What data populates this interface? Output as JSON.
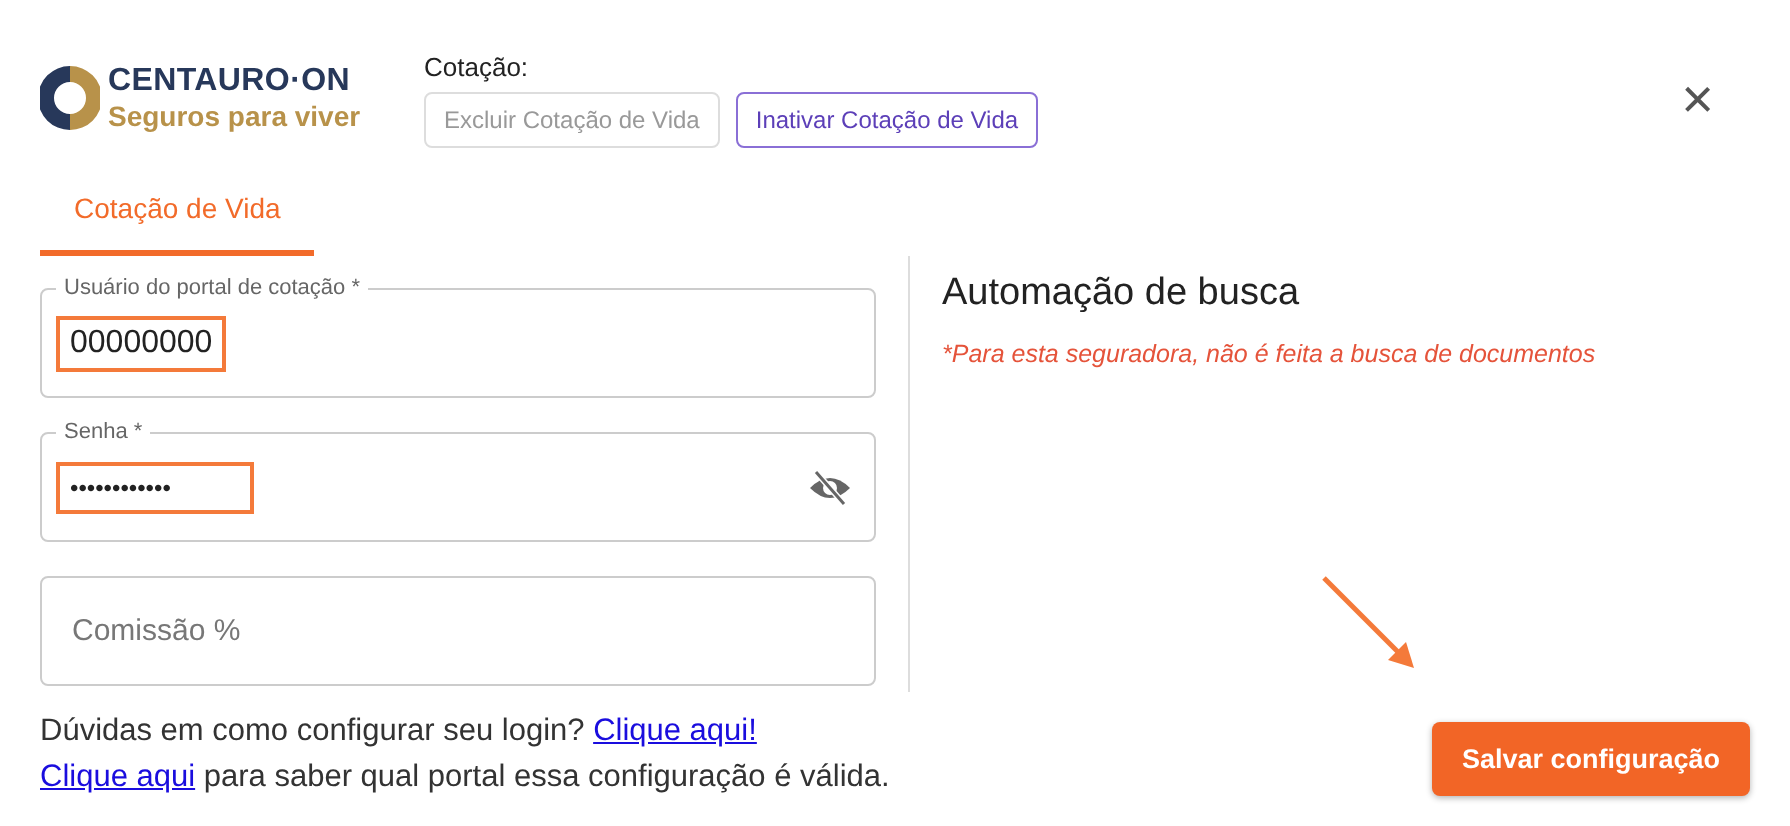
{
  "logo": {
    "name": "CENTAURO·ON",
    "tagline": "Seguros para viver"
  },
  "cotacao": {
    "label": "Cotação:",
    "buttons": [
      {
        "label": "Excluir Cotação de Vida",
        "disabled": true
      },
      {
        "label": "Inativar Cotação de Vida",
        "disabled": false
      }
    ]
  },
  "close": "×",
  "tabs": [
    {
      "label": "Cotação de Vida",
      "selected": true
    }
  ],
  "fields": [
    {
      "kind": "text",
      "label": "Usuário do portal de cotação *",
      "value": "00000000",
      "highlighted": true
    },
    {
      "kind": "password",
      "label": "Senha *",
      "value": "••••••••••••",
      "highlighted": true
    },
    {
      "kind": "empty",
      "placeholder": "Comissão %",
      "highlighted": false
    }
  ],
  "help": [
    {
      "parts": [
        {
          "text": "Dúvidas em como configurar seu login?",
          "link": false
        },
        {
          "text": "Clique aqui!",
          "link": true
        }
      ]
    },
    {
      "parts": [
        {
          "text": "Clique aqui",
          "link": true
        },
        {
          "text": "para saber qual portal essa configuração é válida.",
          "link": false
        }
      ]
    }
  ],
  "automation": {
    "title": "Automação de busca",
    "note": "*Para esta seguradora, não é feita a busca de documentos"
  },
  "save_button": {
    "label": "Salvar configuração",
    "pointed_at": true
  }
}
